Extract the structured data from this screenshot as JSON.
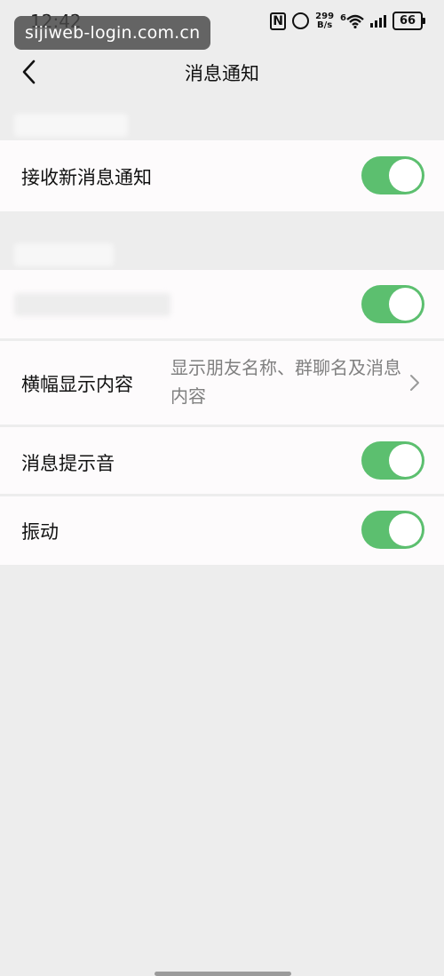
{
  "status_bar": {
    "time": "12:42",
    "net_speed": "299",
    "net_speed_unit": "B/s",
    "wifi_gen": "6",
    "battery": "66"
  },
  "watermark": "sijiweb-login.com.cn",
  "nav": {
    "title": "消息通知",
    "back_icon": "chevron-left-icon"
  },
  "settings": {
    "receive_new": {
      "label": "接收新消息通知",
      "enabled": true
    },
    "hidden_toggle": {
      "enabled": true
    },
    "banner": {
      "label": "横幅显示内容",
      "value": "显示朋友名称、群聊名及消息内容"
    },
    "sound": {
      "label": "消息提示音",
      "enabled": true
    },
    "vibrate": {
      "label": "振动",
      "enabled": true
    }
  },
  "colors": {
    "toggle_on": "#5cbf6f",
    "background": "#ededed",
    "cell_background": "#fdfbfc",
    "secondary_text": "#808080"
  }
}
